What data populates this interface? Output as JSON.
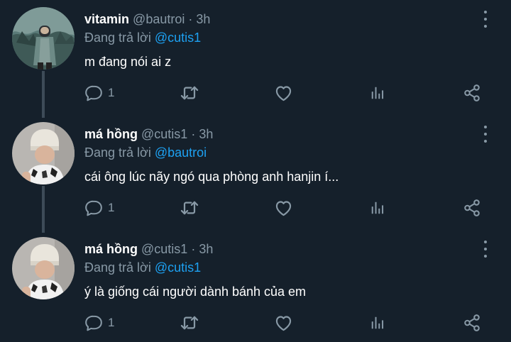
{
  "colors": {
    "background": "#15202b",
    "primary_text": "#ffffff",
    "secondary_text": "#8899a6",
    "mention": "#1da1f2",
    "thread_line": "#3d4b58"
  },
  "icons": {
    "reply": "comment-bubble-icon",
    "retweet": "retweet-arrows-icon",
    "like": "heart-outline-icon",
    "analytics": "bar-chart-icon",
    "share": "share-nodes-icon",
    "more": "vertical-ellipsis-icon"
  },
  "tweets": [
    {
      "display_name": "vitamin",
      "handle": "@bautroi",
      "separator": "·",
      "time": "3h",
      "replying_prefix": "Đang trả lời",
      "replying_to": "@cutis1",
      "text": "m đang nói ai z",
      "reply_count": "1"
    },
    {
      "display_name": "má hồng",
      "handle": "@cutis1",
      "separator": "·",
      "time": "3h",
      "replying_prefix": "Đang trả lời",
      "replying_to": "@bautroi",
      "text": "cái ông lúc nãy ngó qua phòng anh hanjin í...",
      "reply_count": "1"
    },
    {
      "display_name": "má hồng",
      "handle": "@cutis1",
      "separator": "·",
      "time": "3h",
      "replying_prefix": "Đang trả lời",
      "replying_to": "@cutis1",
      "text": "ý là giống cái người dành bánh của em",
      "reply_count": "1"
    }
  ]
}
